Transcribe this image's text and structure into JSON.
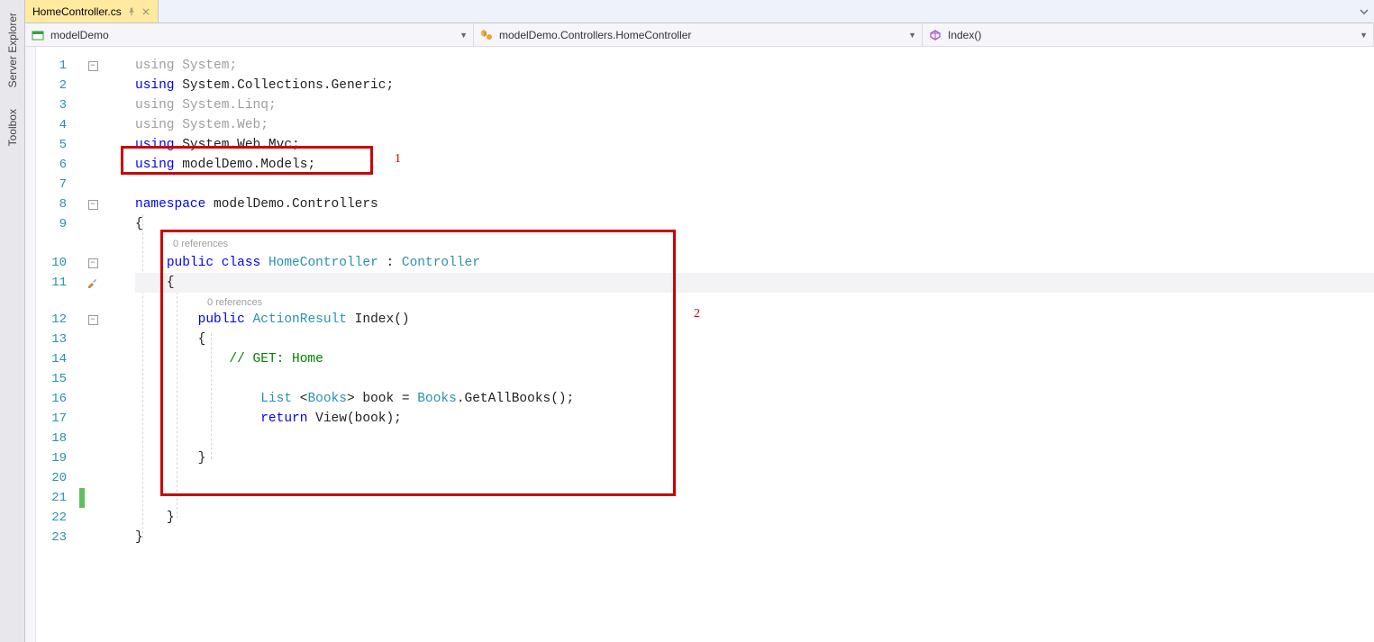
{
  "side_panels": {
    "server_explorer": "Server Explorer",
    "toolbox": "Toolbox"
  },
  "tab": {
    "title": "HomeController.cs"
  },
  "nav": {
    "project": "modelDemo",
    "class": "modelDemo.Controllers.HomeController",
    "member": "Index()"
  },
  "codelens": {
    "class_refs": "0 references",
    "method_refs": "0 references"
  },
  "annotations": {
    "label1": "1",
    "label2": "2"
  },
  "gutter": {
    "line_numbers": [
      "1",
      "2",
      "3",
      "4",
      "5",
      "6",
      "7",
      "8",
      "9",
      "10",
      "11",
      "12",
      "13",
      "14",
      "15",
      "16",
      "17",
      "18",
      "19",
      "20",
      "21",
      "22",
      "23"
    ]
  },
  "code": {
    "l1_using": "using",
    "l1_ns": "System",
    "l1_semi": ";",
    "l2_using": "using",
    "l2_ns": "System.Collections.Generic",
    "l2_semi": ";",
    "l3_using": "using",
    "l3_ns": "System.Linq",
    "l3_semi": ";",
    "l4_using": "using",
    "l4_ns": "System.Web",
    "l4_semi": ";",
    "l5_using": "using",
    "l5_ns": "System.Web.Mvc",
    "l5_semi": ";",
    "l6_using": "using",
    "l6_ns": "modelDemo.Models",
    "l6_semi": ";",
    "l8_ns_kw": "namespace",
    "l8_ns_name": "modelDemo.Controllers",
    "l9_brace": "{",
    "l10_pub": "public",
    "l10_class": "class",
    "l10_name": "HomeController",
    "l10_colon": " : ",
    "l10_base": "Controller",
    "l11_brace": "{",
    "l12_pub": "public",
    "l12_ret": "ActionResult",
    "l12_name": "Index",
    "l12_paren": "()",
    "l13_brace": "{",
    "l14_comment": "// GET: Home",
    "l16_list": "List",
    "l16_open": " <",
    "l16_books1": "Books",
    "l16_close": "> book = ",
    "l16_books2": "Books",
    "l16_tail": ".GetAllBooks();",
    "l17_return": "return",
    "l17_tail": " View(book);",
    "l19_brace": "}",
    "l22_brace": "}",
    "l23_brace": "}"
  }
}
